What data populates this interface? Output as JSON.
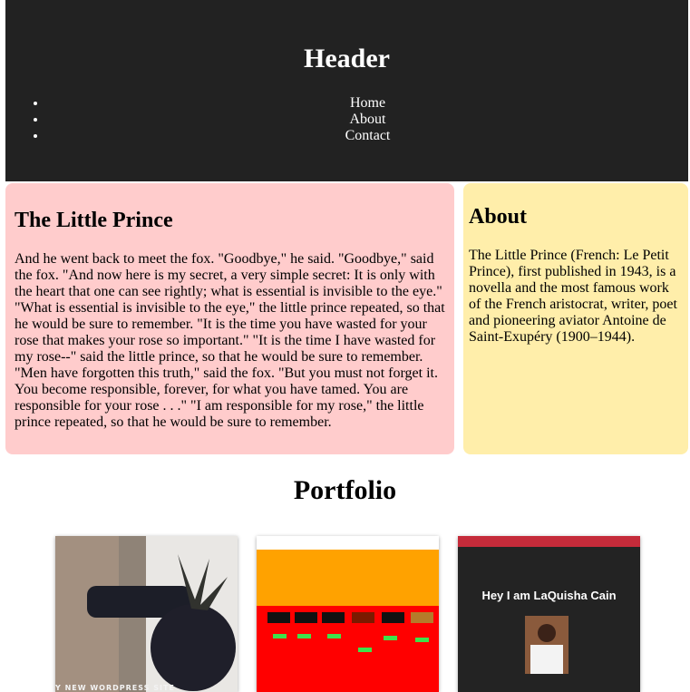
{
  "header": {
    "title": "Header",
    "nav": [
      "Home",
      "About",
      "Contact"
    ]
  },
  "main": {
    "title": "The Little Prince",
    "body": "And he went back to meet the fox. \"Goodbye,\" he said. \"Goodbye,\" said the fox. \"And now here is my secret, a very simple secret: It is only with the heart that one can see rightly; what is essential is invisible to the eye.\" \"What is essential is invisible to the eye,\" the little prince repeated, so that he would be sure to remember. \"It is the time you have wasted for your rose that makes your rose so important.\" \"It is the time I have wasted for my rose--\" said the little prince, so that he would be sure to remember. \"Men have forgotten this truth,\" said the fox. \"But you must not forget it. You become responsible, forever, for what you have tamed. You are responsible for your rose . . .\" \"I am responsible for my rose,\" the little prince repeated, so that he would be sure to remember."
  },
  "aside": {
    "title": "About",
    "body": "The Little Prince (French: Le Petit Prince), first published in 1943, is a novella and the most famous work of the French aristocrat, writer, poet and pioneering aviator Antoine de Saint-Exupéry (1900–1944)."
  },
  "portfolio": {
    "title": "Portfolio",
    "items": [
      {
        "caption": "Y NEW WORDPRESS SITE"
      },
      {
        "caption": ""
      },
      {
        "caption": "Hey I am LaQuisha Cain"
      }
    ]
  }
}
